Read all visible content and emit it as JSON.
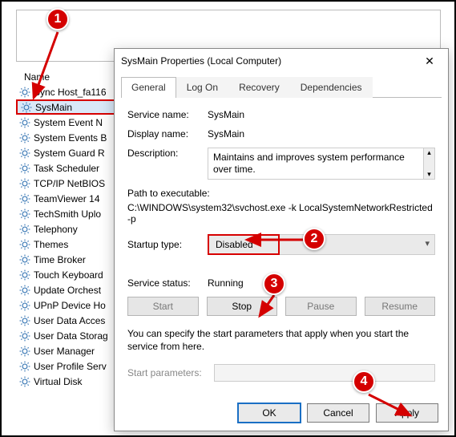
{
  "list": {
    "column_header": "Name",
    "items": [
      "Sync Host_fa116",
      "SysMain",
      "System Event N",
      "System Events B",
      "System Guard R",
      "Task Scheduler",
      "TCP/IP NetBIOS",
      "TeamViewer 14",
      "TechSmith Uplo",
      "Telephony",
      "Themes",
      "Time Broker",
      "Touch Keyboard",
      "Update Orchest",
      "UPnP Device Ho",
      "User Data Acces",
      "User Data Storag",
      "User Manager",
      "User Profile Serv",
      "Virtual Disk"
    ],
    "selected_index": 1
  },
  "dialog": {
    "title": "SysMain Properties (Local Computer)",
    "tabs": [
      "General",
      "Log On",
      "Recovery",
      "Dependencies"
    ],
    "active_tab": 0,
    "labels": {
      "service_name": "Service name:",
      "display_name": "Display name:",
      "description": "Description:",
      "path": "Path to executable:",
      "startup_type": "Startup type:",
      "service_status": "Service status:",
      "start_parameters": "Start parameters:",
      "note": "You can specify the start parameters that apply when you start the service from here."
    },
    "values": {
      "service_name": "SysMain",
      "display_name": "SysMain",
      "description": "Maintains and improves system performance over time.",
      "path": "C:\\WINDOWS\\system32\\svchost.exe -k LocalSystemNetworkRestricted -p",
      "startup_type": "Disabled",
      "service_status": "Running"
    },
    "buttons": {
      "start": "Start",
      "stop": "Stop",
      "pause": "Pause",
      "resume": "Resume",
      "ok": "OK",
      "cancel": "Cancel",
      "apply": "Apply"
    }
  },
  "callouts": {
    "c1": "1",
    "c2": "2",
    "c3": "3",
    "c4": "4"
  }
}
